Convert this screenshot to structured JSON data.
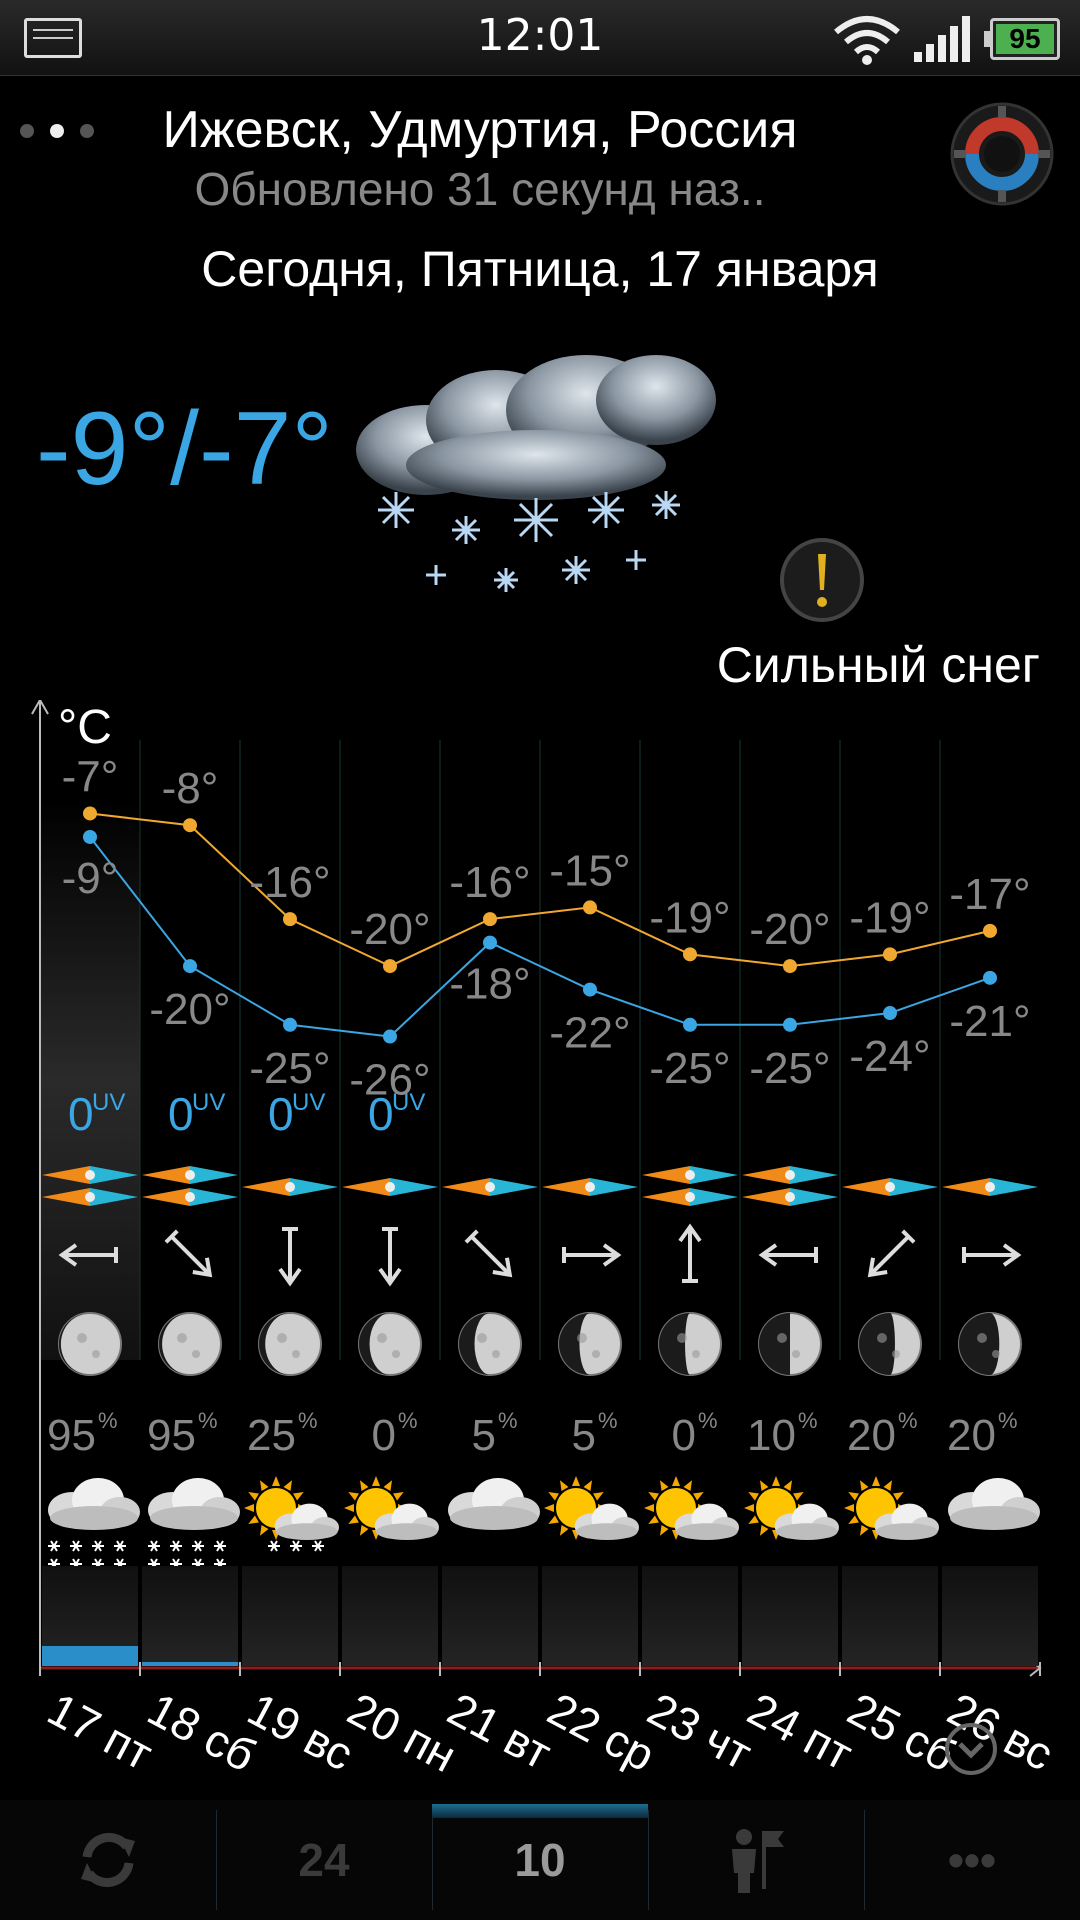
{
  "status_bar": {
    "time": "12:01",
    "battery": "95"
  },
  "header": {
    "city": "Ижевск, Удмуртия, Россия",
    "updated": "Обновлено 31 секунд наз..",
    "date": "Сегодня, Пятница, 17 января"
  },
  "current": {
    "temperature": "-9°/-7°",
    "condition": "Сильный снег",
    "icon": "heavy-snow-icon"
  },
  "forecast": {
    "unit": "°C",
    "days": [
      {
        "label": "17 пт",
        "high": -7,
        "low": -9,
        "uv": "0",
        "wind_dir": "west",
        "wind_strength": 2,
        "precip": "95",
        "icon": "snow",
        "moon_phase": 0.97,
        "precip_bar": 1.0
      },
      {
        "label": "18 сб",
        "high": -8,
        "low": -20,
        "uv": "0",
        "wind_dir": "southeast",
        "wind_strength": 2,
        "precip": "95",
        "icon": "snow",
        "moon_phase": 0.95,
        "precip_bar": 0.2
      },
      {
        "label": "19 вс",
        "high": -16,
        "low": -25,
        "uv": "0",
        "wind_dir": "south",
        "wind_strength": 1,
        "precip": "25",
        "icon": "sun-cloud-snow",
        "moon_phase": 0.9,
        "precip_bar": 0
      },
      {
        "label": "20 пн",
        "high": -20,
        "low": -26,
        "uv": "0",
        "wind_dir": "south",
        "wind_strength": 1,
        "precip": "0",
        "icon": "sun-cloud",
        "moon_phase": 0.83,
        "precip_bar": 0
      },
      {
        "label": "21 вт",
        "high": -16,
        "low": -18,
        "uv": "",
        "wind_dir": "southeast",
        "wind_strength": 1,
        "precip": "5",
        "icon": "cloud",
        "moon_phase": 0.75,
        "precip_bar": 0
      },
      {
        "label": "22 ср",
        "high": -15,
        "low": -22,
        "uv": "",
        "wind_dir": "east",
        "wind_strength": 1,
        "precip": "5",
        "icon": "sun-cloud",
        "moon_phase": 0.67,
        "precip_bar": 0
      },
      {
        "label": "23 чт",
        "high": -19,
        "low": -25,
        "uv": "",
        "wind_dir": "north",
        "wind_strength": 2,
        "precip": "0",
        "icon": "sun-cloud",
        "moon_phase": 0.58,
        "precip_bar": 0
      },
      {
        "label": "24 пт",
        "high": -20,
        "low": -25,
        "uv": "",
        "wind_dir": "west",
        "wind_strength": 2,
        "precip": "10",
        "icon": "sun-cloud",
        "moon_phase": 0.5,
        "precip_bar": 0
      },
      {
        "label": "25 сб",
        "high": -19,
        "low": -24,
        "uv": "",
        "wind_dir": "southwest",
        "wind_strength": 1,
        "precip": "20",
        "icon": "sun-cloud",
        "moon_phase": 0.42,
        "precip_bar": 0
      },
      {
        "label": "26 вс",
        "high": -17,
        "low": -21,
        "uv": "",
        "wind_dir": "east",
        "wind_strength": 1,
        "precip": "20",
        "icon": "cloud",
        "moon_phase": 0.35,
        "precip_bar": 0
      }
    ]
  },
  "chart_data": {
    "type": "line",
    "categories": [
      "17 пт",
      "18 сб",
      "19 вс",
      "20 пн",
      "21 вт",
      "22 ср",
      "23 чт",
      "24 пт",
      "25 сб",
      "26 вс"
    ],
    "series": [
      {
        "values": [
          -7,
          -8,
          -16,
          -20,
          -16,
          -15,
          -19,
          -20,
          -19,
          -17
        ],
        "color": "#f0a830"
      },
      {
        "values": [
          -9,
          -20,
          -25,
          -26,
          -18,
          -22,
          -25,
          -25,
          -24,
          -21
        ],
        "color": "#3aa6e3"
      }
    ],
    "ylabel": "°C",
    "ylim": [
      -28,
      -5
    ]
  },
  "bottom_bar": {
    "refresh_icon": "refresh-icon",
    "hourly": "24",
    "daily": "10",
    "locations_icon": "person-flag-icon",
    "more": "•••"
  },
  "colors": {
    "accent": "#3aa6e3",
    "high_line": "#f0a830",
    "low_line": "#3aa6e3",
    "text_dim": "#888888"
  }
}
